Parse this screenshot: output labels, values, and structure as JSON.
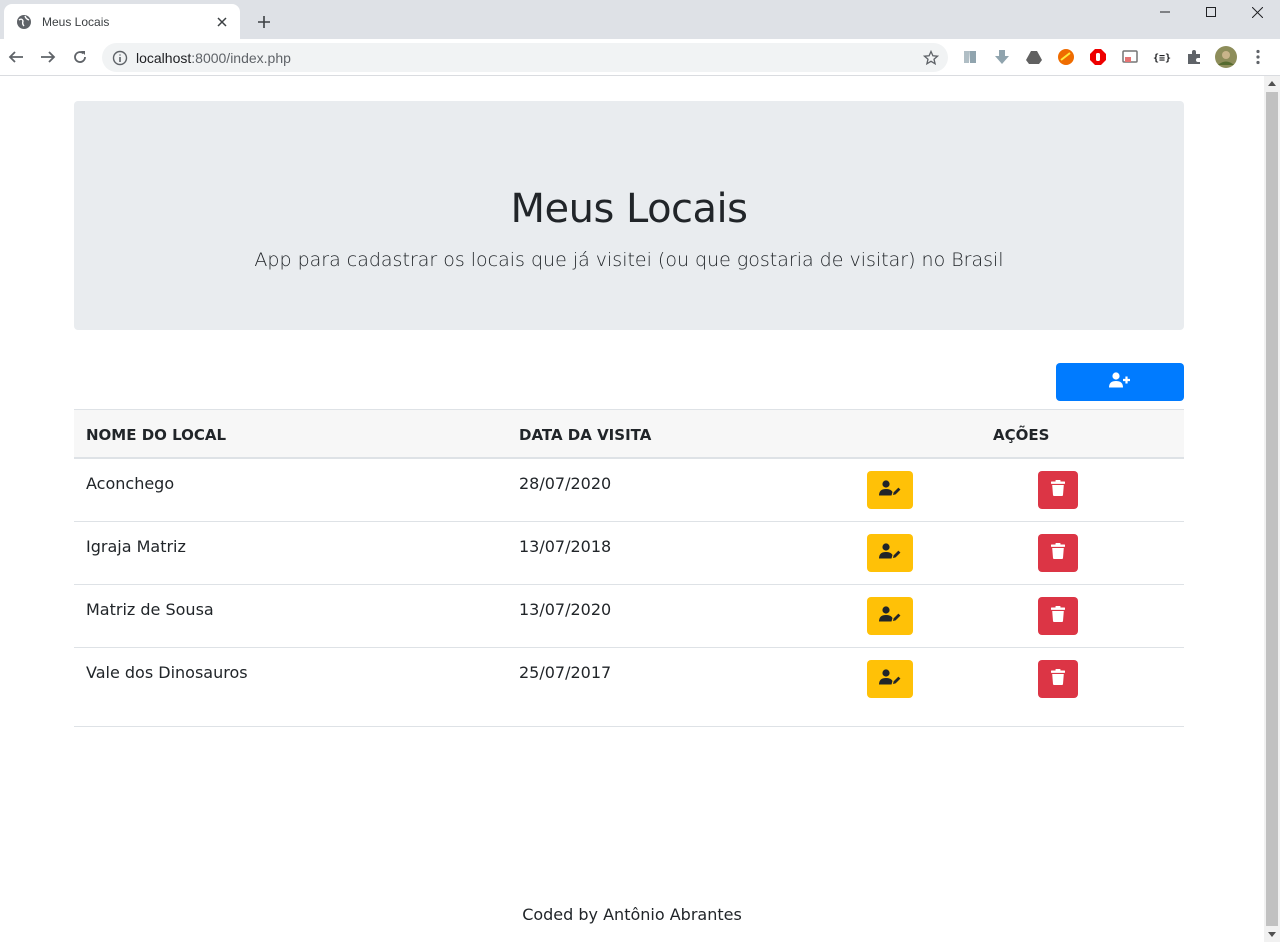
{
  "browser": {
    "tab_title": "Meus Locais",
    "url_host": "localhost",
    "url_path": ":8000/index.php"
  },
  "page": {
    "title": "Meus Locais",
    "subtitle": "App para cadastrar os locais que já visitei (ou que gostaria de visitar) no Brasil",
    "add_button_icon": "user-plus-icon",
    "table": {
      "headers": [
        "NOME DO LOCAL",
        "DATA DA VISITA",
        "AÇÕES"
      ],
      "rows": [
        {
          "name": "Aconchego",
          "date": "28/07/2020"
        },
        {
          "name": "Igraja Matriz",
          "date": "13/07/2018"
        },
        {
          "name": "Matriz de Sousa",
          "date": "13/07/2020"
        },
        {
          "name": "Vale dos Dinosauros",
          "date": "25/07/2017"
        }
      ],
      "edit_icon": "user-edit-icon",
      "delete_icon": "trash-icon"
    },
    "footer": "Coded by Antônio Abrantes"
  },
  "colors": {
    "primary": "#007bff",
    "warning": "#ffc107",
    "danger": "#dc3545",
    "jumbotron_bg": "#e9ecef"
  }
}
